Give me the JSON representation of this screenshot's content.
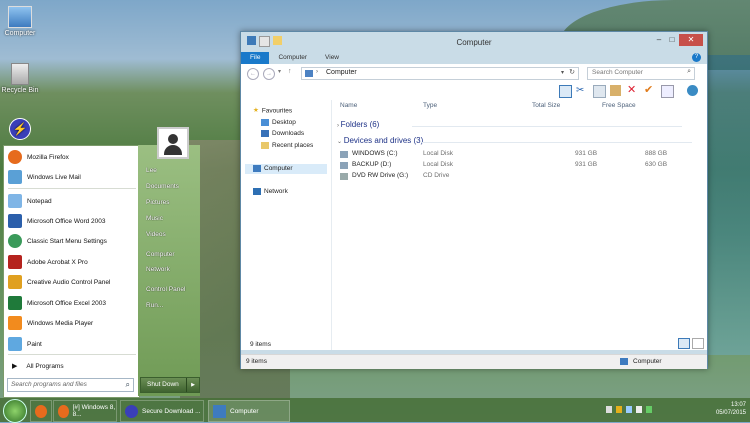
{
  "desktop": {
    "icons": [
      {
        "label": "Computer",
        "icon": "computer-icon"
      },
      {
        "label": "Recycle Bin",
        "icon": "recycle-bin-icon"
      },
      {
        "label": "",
        "icon": "secure-download-icon"
      }
    ]
  },
  "explorer": {
    "title": "Computer",
    "ribbon_tabs": [
      "File",
      "Computer",
      "View"
    ],
    "address_path": "Computer",
    "search_placeholder": "Search Computer",
    "help": "?",
    "nav": {
      "favourites": "Favourites",
      "favourites_items": [
        "Desktop",
        "Downloads",
        "Recent places"
      ],
      "computer": "Computer",
      "network": "Network"
    },
    "columns": {
      "name": "Name",
      "type": "Type",
      "total_size": "Total Size",
      "free_space": "Free Space"
    },
    "groups": {
      "folders": "Folders (6)",
      "drives": "Devices and drives (3)"
    },
    "drives": [
      {
        "name": "WINDOWS (C:)",
        "type": "Local Disk",
        "total": "931 GB",
        "free": "888 GB"
      },
      {
        "name": "BACKUP (D:)",
        "type": "Local Disk",
        "total": "931 GB",
        "free": "630 GB"
      },
      {
        "name": "DVD RW Drive (G:)",
        "type": "CD Drive",
        "total": "",
        "free": ""
      }
    ],
    "item_count_main": "9 items",
    "status_left": "9 items",
    "status_right": "Computer"
  },
  "start_menu": {
    "pinned": [
      "Mozilla Firefox",
      "Windows Live Mail",
      "Notepad",
      "Microsoft Office Word 2003",
      "Classic Start Menu Settings",
      "Adobe Acrobat X Pro",
      "Creative Audio Control Panel",
      "Microsoft Office Excel 2003",
      "Windows Media Player",
      "Paint"
    ],
    "all_programs": "All Programs",
    "search_placeholder": "Search programs and files",
    "right_items": [
      "Lee",
      "Documents",
      "Pictures",
      "Music",
      "Videos",
      "Computer",
      "Network",
      "Control Panel",
      "Run..."
    ],
    "shutdown": "Shut Down"
  },
  "taskbar": {
    "buttons": [
      "[#] Windows 8, 8...",
      "Secure Download ...",
      "Computer"
    ],
    "time": "13:07",
    "date": "05/07/2015"
  },
  "colors": {
    "accent": "#1979ca",
    "group_header": "#1e3287"
  }
}
